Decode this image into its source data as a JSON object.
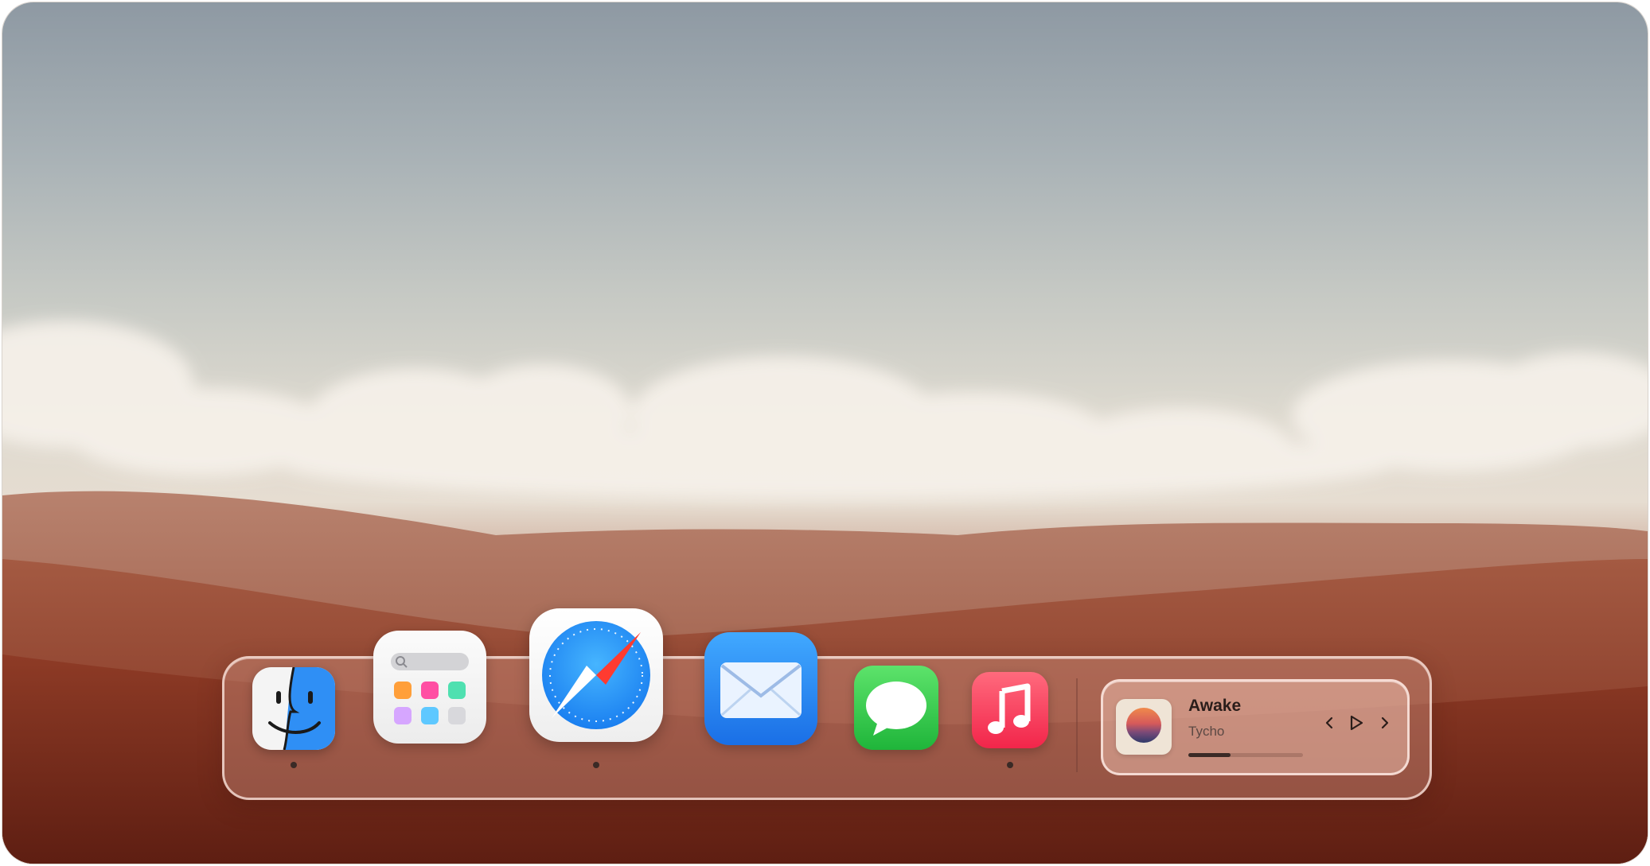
{
  "wallpaper": {
    "name": "rolling-hills-wallpaper"
  },
  "dock": {
    "apps": [
      {
        "id": "finder",
        "icon": "finder-icon",
        "running": true
      },
      {
        "id": "launchpad",
        "icon": "launchpad-icon",
        "running": false
      },
      {
        "id": "safari",
        "icon": "safari-icon",
        "running": true
      },
      {
        "id": "mail",
        "icon": "mail-icon",
        "running": false
      },
      {
        "id": "messages",
        "icon": "messages-icon",
        "running": false
      },
      {
        "id": "music",
        "icon": "music-icon",
        "running": true
      }
    ]
  },
  "now_playing": {
    "title": "Awake",
    "artist": "Tycho",
    "progress": 0.37,
    "controls": {
      "previous_icon": "chevron-left-icon",
      "play_icon": "play-icon",
      "next_icon": "chevron-right-icon"
    }
  },
  "colors": {
    "accent_blue": "#1a8cff",
    "mail_blue": "#1a6fe6",
    "messages_green": "#1fb53a",
    "music_red": "#f2254a"
  }
}
